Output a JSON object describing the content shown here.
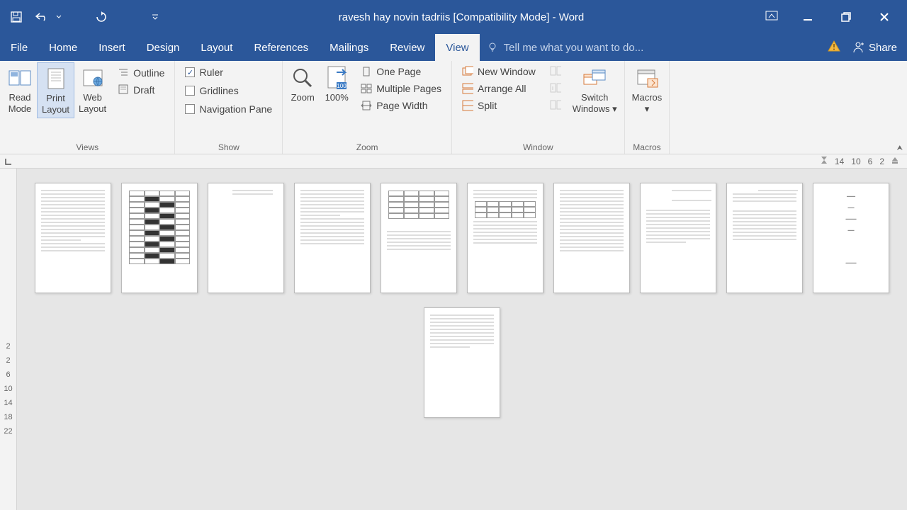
{
  "title": "ravesh hay novin tadriis [Compatibility Mode] - Word",
  "menu": {
    "file": "File",
    "home": "Home",
    "insert": "Insert",
    "design": "Design",
    "layout": "Layout",
    "references": "References",
    "mailings": "Mailings",
    "review": "Review",
    "view": "View",
    "tellme": "Tell me what you want to do...",
    "share": "Share"
  },
  "ribbon": {
    "views": {
      "label": "Views",
      "read_mode": "Read\nMode",
      "print_layout": "Print\nLayout",
      "web_layout": "Web\nLayout",
      "outline": "Outline",
      "draft": "Draft"
    },
    "show": {
      "label": "Show",
      "ruler": "Ruler",
      "gridlines": "Gridlines",
      "nav_pane": "Navigation Pane"
    },
    "zoom": {
      "label": "Zoom",
      "zoom": "Zoom",
      "hundred": "100%",
      "one_page": "One Page",
      "multi_pages": "Multiple Pages",
      "page_width": "Page Width"
    },
    "window": {
      "label": "Window",
      "new_window": "New Window",
      "arrange_all": "Arrange All",
      "split": "Split",
      "switch": "Switch\nWindows"
    },
    "macros": {
      "label": "Macros",
      "macros": "Macros"
    }
  },
  "ruler_h": [
    "14",
    "10",
    "6",
    "2"
  ],
  "ruler_v": [
    "2",
    "2",
    "6",
    "10",
    "14",
    "18",
    "22"
  ]
}
